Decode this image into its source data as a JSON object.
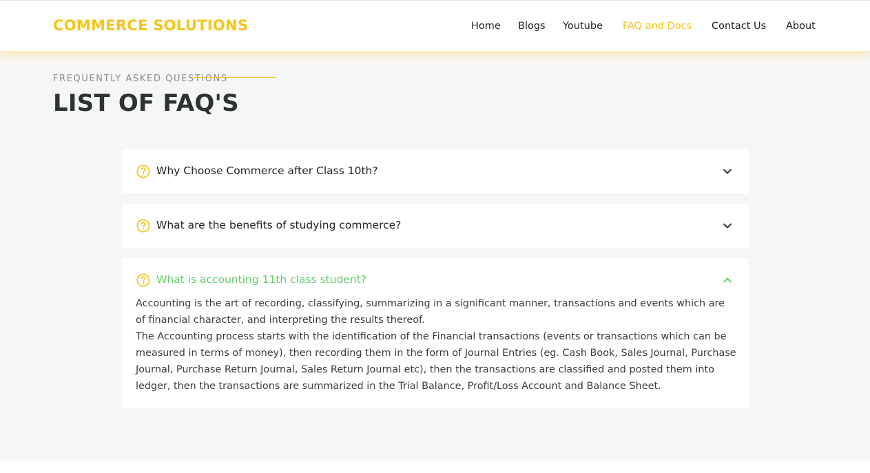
{
  "header": {
    "logo": "COMMERCE SOLUTIONS",
    "nav": [
      {
        "label": "Home",
        "active": false
      },
      {
        "label": "Blogs",
        "active": false
      },
      {
        "label": "Youtube",
        "active": false
      },
      {
        "label": "FAQ and Docs",
        "active": true
      },
      {
        "label": "Contact Us",
        "active": false
      },
      {
        "label": "About",
        "active": false
      }
    ]
  },
  "section": {
    "eyebrow": "FREQUENTLY ASKED QUESTIONS",
    "title": "LIST OF FAQ'S"
  },
  "faqs": [
    {
      "question": "Why Choose Commerce after Class 10th?",
      "expanded": false
    },
    {
      "question": "What are the benefits of studying commerce?",
      "expanded": false
    },
    {
      "question": "What is accounting 11th class student?",
      "expanded": true,
      "answer_p1": "Accounting is the art of recording, classifying, summarizing in a significant manner, transactions and events which are of financial character, and interpreting the results thereof.",
      "answer_p2": "The Accounting process starts with the identification of the Financial transactions (events or transactions which can be measured in terms of money), then recording them in the form of Journal Entries (eg. Cash Book, Sales Journal, Purchase Journal, Purchase Return Journal, Sales Return Journal etc), then the transactions are classified and posted them into ledger, then the transactions are summarized in the Trial Balance, Profit/Loss Account and Balance Sheet."
    }
  ],
  "colors": {
    "accent": "#f5c518",
    "open_question": "#5fcf66",
    "page_bg": "#f6f6f6",
    "title": "#2b3433"
  },
  "icons": {
    "question": "question-circle-icon",
    "collapsed": "chevron-down-icon",
    "expanded": "chevron-up-icon"
  }
}
